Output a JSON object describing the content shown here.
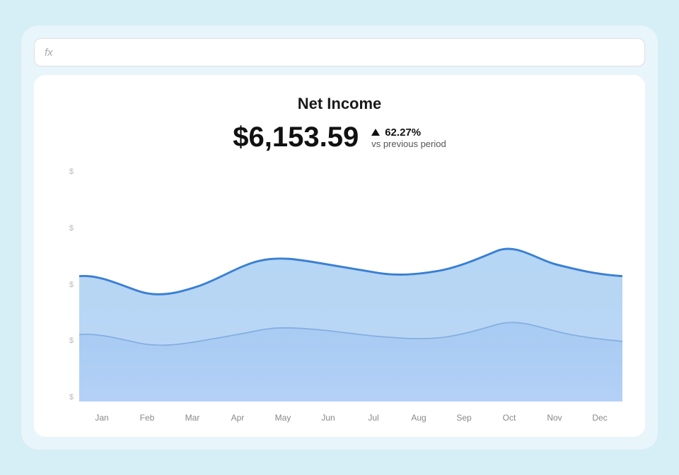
{
  "formula_bar": {
    "text": "fx"
  },
  "card": {
    "title": "Net Income",
    "main_value": "$6,153.59",
    "change_pct": "62.27%",
    "change_label": "vs previous period",
    "y_labels": [
      "$",
      "$",
      "$",
      "$",
      "$"
    ],
    "x_labels": [
      "Jan",
      "Feb",
      "Mar",
      "Apr",
      "May",
      "Jun",
      "Jul",
      "Aug",
      "Sep",
      "Oct",
      "Nov",
      "Dec"
    ]
  }
}
